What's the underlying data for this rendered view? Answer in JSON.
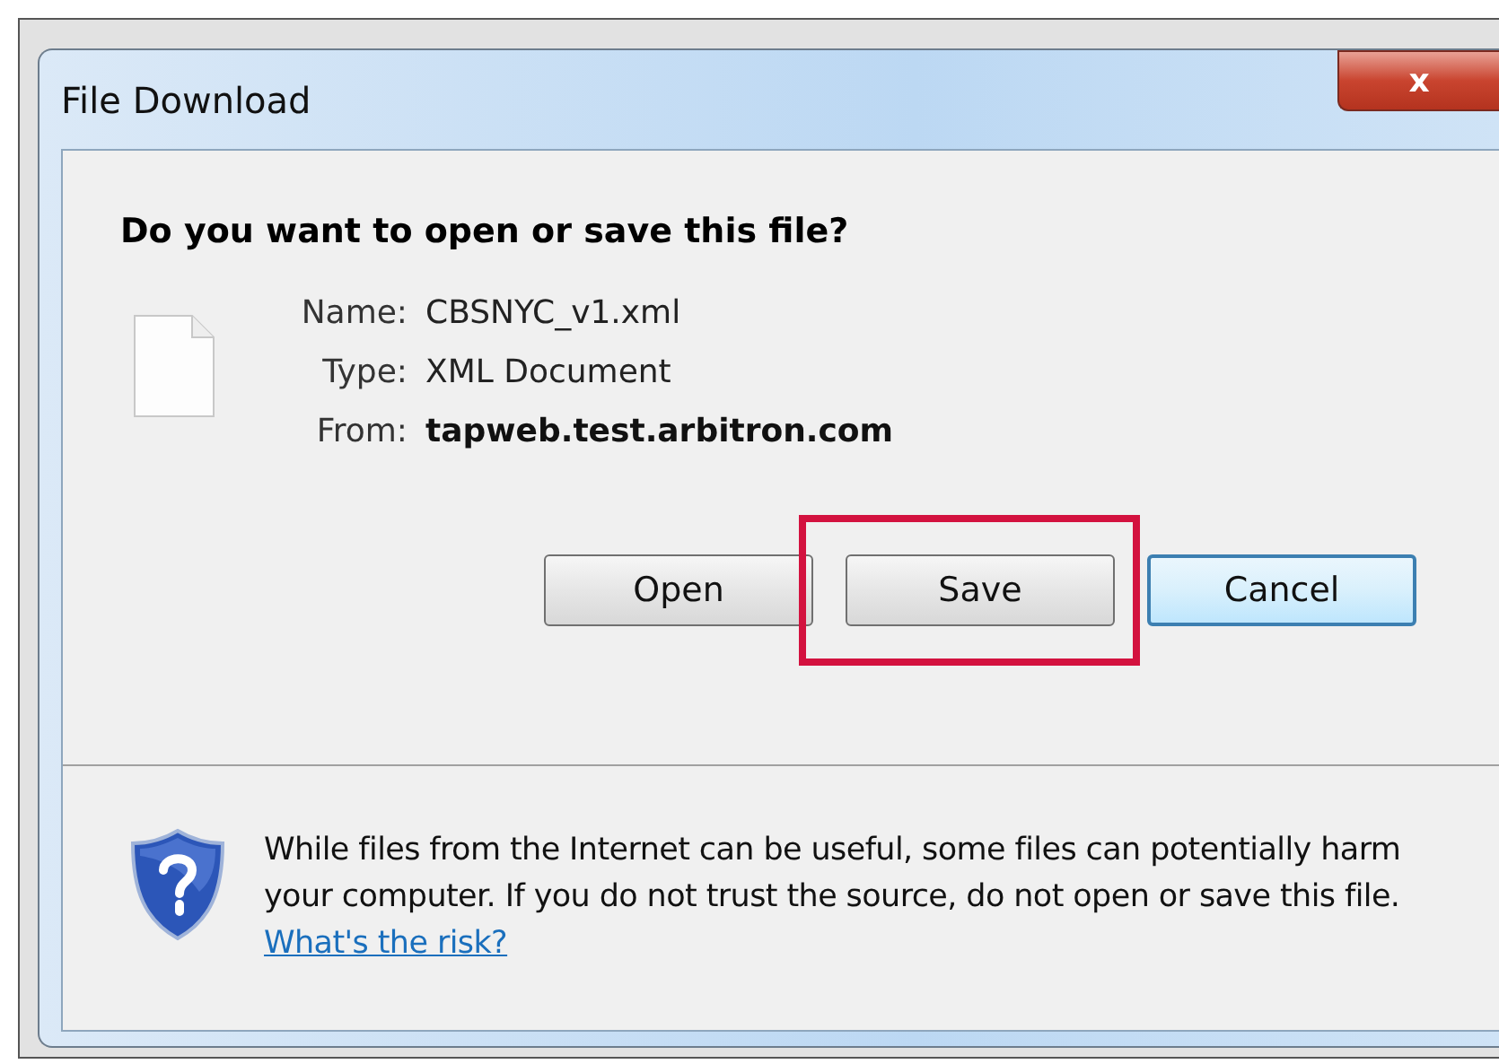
{
  "window": {
    "title": "File Download",
    "close": "x"
  },
  "heading": "Do you want to open or save this file?",
  "details": [
    {
      "label": "Name:",
      "value": "CBSNYC_v1.xml",
      "emphasized": false
    },
    {
      "label": "Type:",
      "value": "XML Document",
      "emphasized": false
    },
    {
      "label": "From:",
      "value": "tapweb.test.arbitron.com",
      "emphasized": true
    }
  ],
  "buttons": [
    {
      "label": "Open",
      "default": false,
      "highlighted": false
    },
    {
      "label": "Save",
      "default": false,
      "highlighted": true
    },
    {
      "label": "Cancel",
      "default": true,
      "highlighted": false
    }
  ],
  "warning": {
    "text": "While files from the Internet can be useful, some files can potentially harm your computer. If you do not trust the source, do not open or save this file.",
    "link": "What's the risk?"
  }
}
